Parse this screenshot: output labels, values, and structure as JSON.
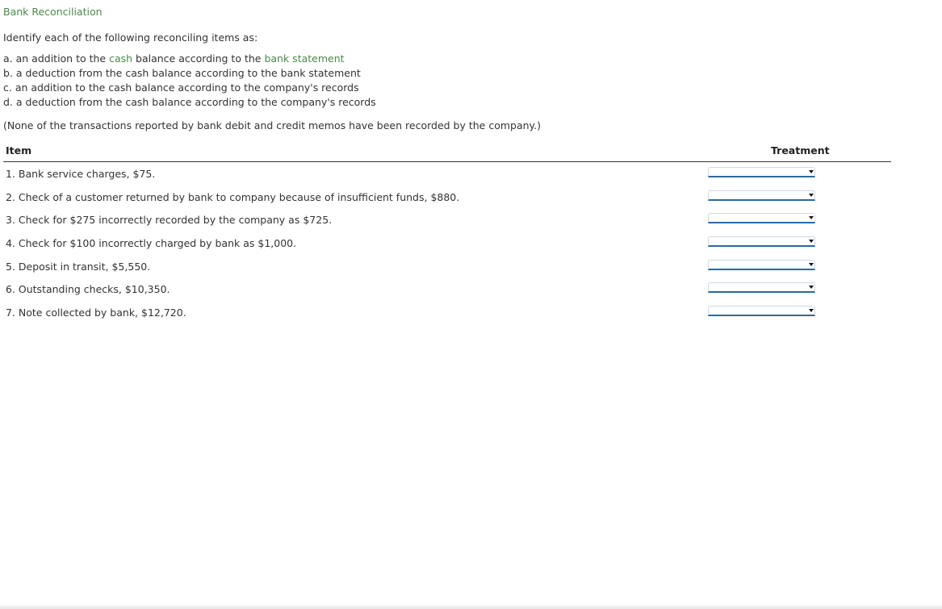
{
  "title": "Bank Reconciliation",
  "intro": "Identify each of the following reconciling items as:",
  "options": {
    "a": {
      "prefix": "a. an addition to the ",
      "link1": "cash",
      "middle": " balance according to the ",
      "link2": "bank statement"
    },
    "b": "b. a deduction from the cash balance according to the bank statement",
    "c": "c. an addition to the cash balance according to the company's records",
    "d": "d. a deduction from the cash balance according to the company's records"
  },
  "note": "(None of the transactions reported by bank debit and credit memos have been recorded by the company.)",
  "table": {
    "header_item": "Item",
    "header_treatment": "Treatment",
    "rows": [
      {
        "item": "1. Bank service charges, $75.",
        "selected": ""
      },
      {
        "item": "2. Check of a customer returned by bank to company because of insufficient funds, $880.",
        "selected": ""
      },
      {
        "item": "3. Check for $275 incorrectly recorded by the company as $725.",
        "selected": ""
      },
      {
        "item": "4. Check for $100 incorrectly charged by bank as $1,000.",
        "selected": ""
      },
      {
        "item": "5. Deposit in transit, $5,550.",
        "selected": ""
      },
      {
        "item": "6. Outstanding checks, $10,350.",
        "selected": ""
      },
      {
        "item": "7. Note collected by bank, $12,720.",
        "selected": ""
      }
    ]
  },
  "colors": {
    "accent_green": "#4a8a4a",
    "select_border": "#2a6aa0"
  }
}
